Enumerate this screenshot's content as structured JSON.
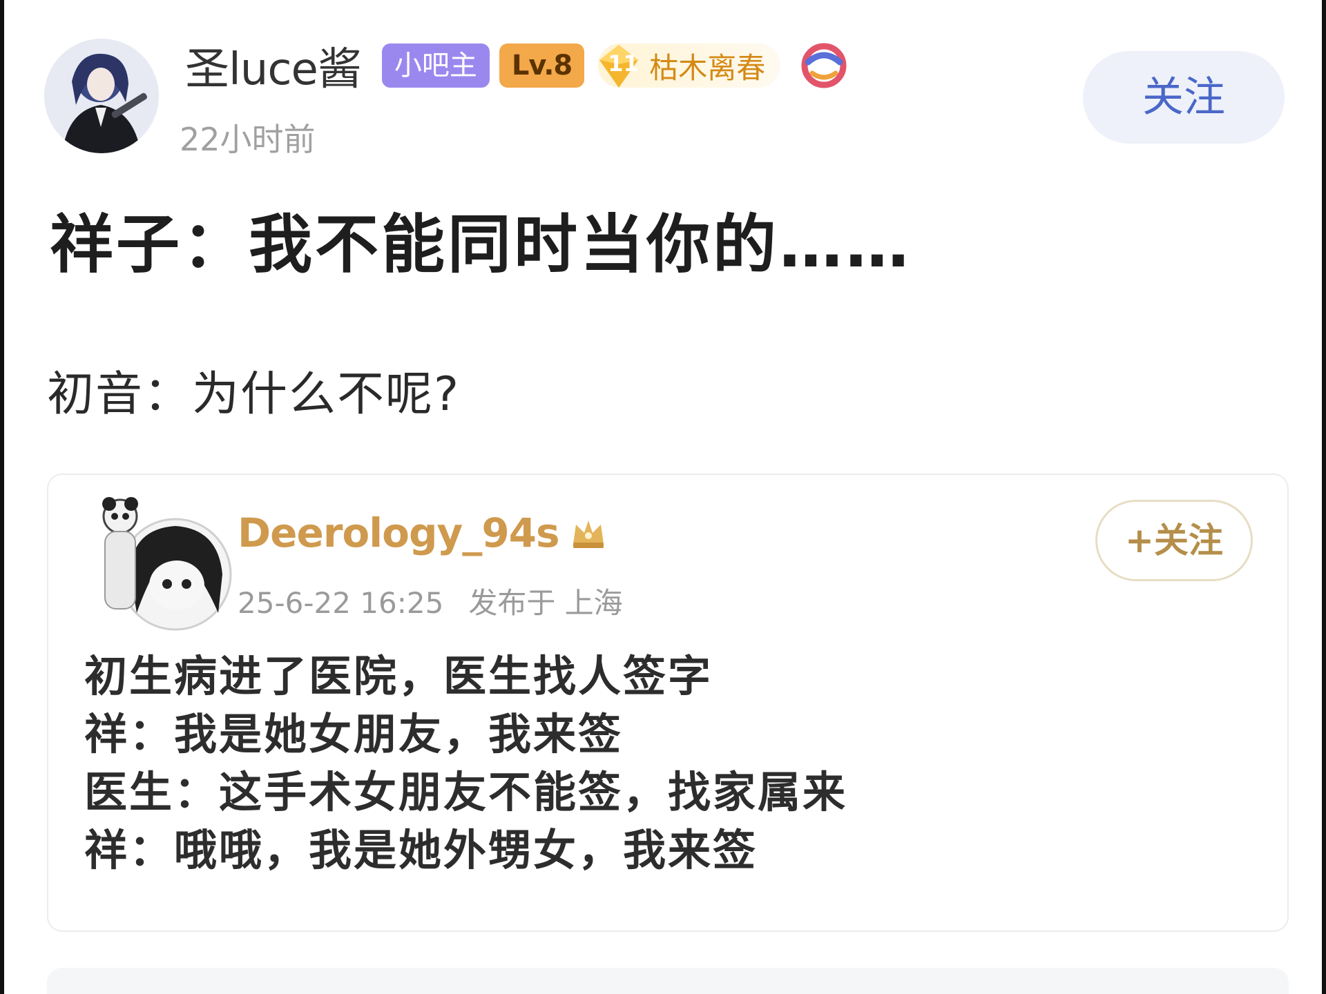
{
  "post": {
    "author": {
      "username": "圣luce酱",
      "badge_owner": "小吧主",
      "badge_level": "Lv.8",
      "title_badge": {
        "gem_number": "11",
        "text": "枯木离春"
      }
    },
    "timestamp": "22小时前",
    "follow_label": "关注",
    "title": "祥子：我不能同时当你的……",
    "body": "初音：为什么不呢?"
  },
  "quote": {
    "username": "Deerology_94s",
    "date": "25-6-22 16:25",
    "location": "发布于 上海",
    "follow_label": "+关注",
    "lines": [
      "初生病进了医院，医生找人签字",
      "祥：我是她女朋友，我来签",
      "医生：这手术女朋友不能签，找家属来",
      "祥：哦哦，我是她外甥女，我来签"
    ]
  },
  "colors": {
    "badge_owner": "#9b88ee",
    "badge_level": "#f3a84a",
    "title_badge_text": "#d48a15",
    "follow_text": "#4a67c9",
    "follow_bg": "#eef1f9",
    "quote_username": "#cf9a4e"
  },
  "icons": {
    "title_gem": "diamond-gem-icon",
    "extra_badge": "swirl-badge-icon",
    "vip_crown": "crown-icon"
  }
}
